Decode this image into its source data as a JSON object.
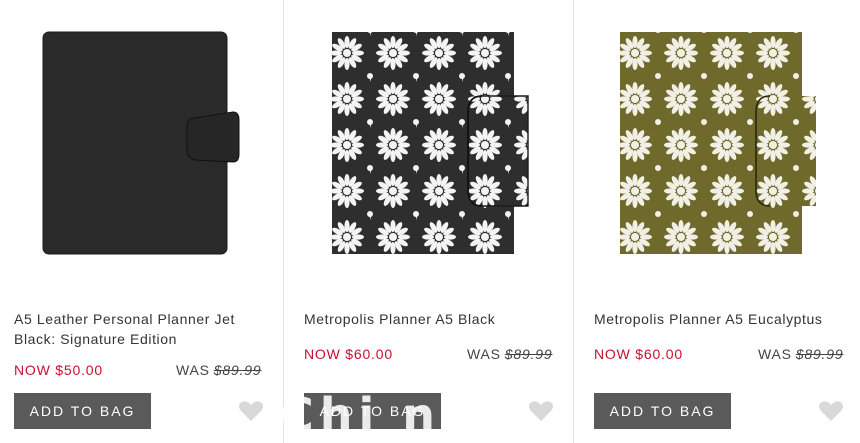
{
  "products": [
    {
      "title_line1": "A5 Leather Personal Planner Jet",
      "title_line2": "Black: Signature Edition",
      "now_label": "NOW $50.00",
      "was_label": "WAS",
      "was_price": "$89.99",
      "button_label": "ADD TO BAG",
      "image_icon": "black-leather-planner-image",
      "color": "#2a2a2a"
    },
    {
      "title_line1": "Metropolis Planner A5 Black",
      "title_line2": "",
      "now_label": "NOW $60.00",
      "was_label": "WAS",
      "was_price": "$89.99",
      "button_label": "ADD TO BAG",
      "image_icon": "black-white-star-pattern-planner-image",
      "color": "#3a3a3a"
    },
    {
      "title_line1": "Metropolis Planner A5 Eucalyptus",
      "title_line2": "",
      "now_label": "NOW $60.00",
      "was_label": "WAS",
      "was_price": "$89.99",
      "button_label": "ADD TO BAG",
      "image_icon": "olive-white-star-pattern-planner-image",
      "color": "#6f6a2c"
    }
  ],
  "colors": {
    "sale_red": "#c8102e",
    "button_gray": "#5a5a5a",
    "heart_gray": "#d9d9d9"
  },
  "watermark": "Chi na"
}
